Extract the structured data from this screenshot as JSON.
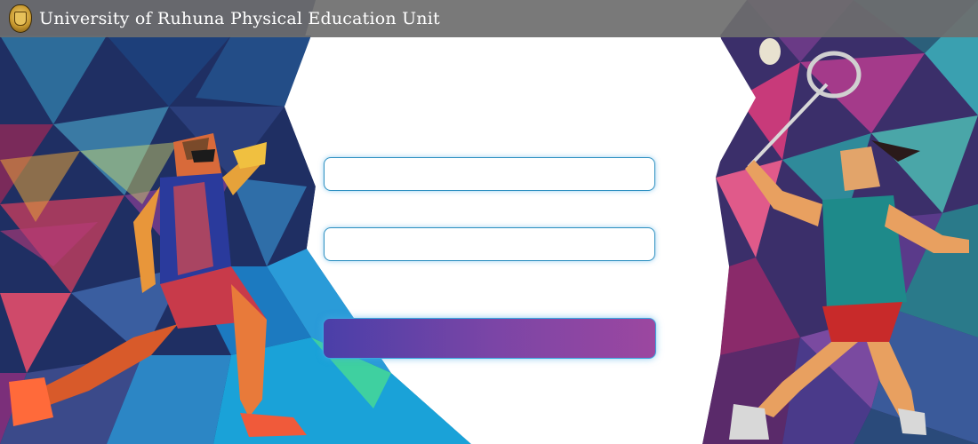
{
  "header": {
    "title": "University of Ruhuna Physical Education Unit",
    "logo_icon": "university-crest-icon"
  },
  "login_form": {
    "username": {
      "value": "",
      "placeholder": ""
    },
    "password": {
      "value": "",
      "placeholder": ""
    },
    "submit_label": ""
  },
  "illustrations": {
    "left": "runner-illustration",
    "right": "badminton-player-illustration"
  },
  "colors": {
    "header_bar": "#6e6e6e",
    "field_border": "#2c8fc0",
    "button_gradient_start": "#4a3fa8",
    "button_gradient_end": "#9c47a0"
  }
}
